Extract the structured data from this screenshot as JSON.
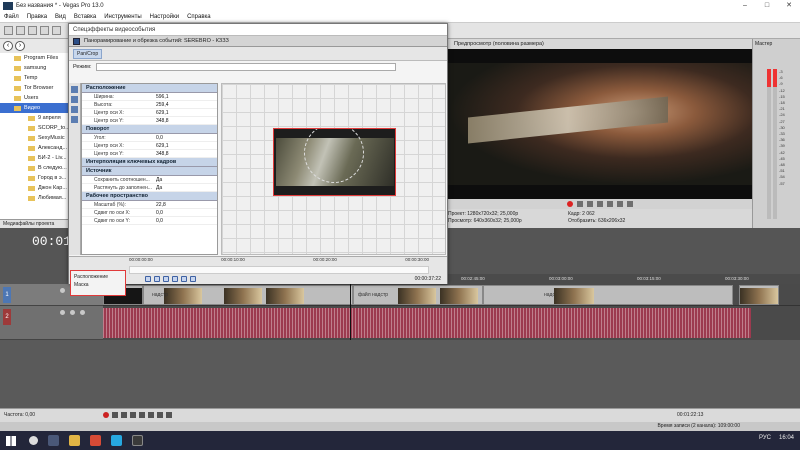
{
  "window": {
    "title": "Без названия * - Vegas Pro 13.0",
    "controls": [
      "–",
      "□",
      "✕"
    ]
  },
  "menu": [
    "Файл",
    "Правка",
    "Вид",
    "Вставка",
    "Инструменты",
    "Настройки",
    "Справка"
  ],
  "explorer": {
    "items": [
      {
        "label": "Program Files",
        "sel": false,
        "sub": false
      },
      {
        "label": "samsung",
        "sel": false,
        "sub": false
      },
      {
        "label": "Temp",
        "sel": false,
        "sub": false
      },
      {
        "label": "Tor Browser",
        "sel": false,
        "sub": false
      },
      {
        "label": "Users",
        "sel": false,
        "sub": false
      },
      {
        "label": "Видео",
        "sel": true,
        "sub": false
      },
      {
        "label": "9 апреля",
        "sel": false,
        "sub": true
      },
      {
        "label": "SCORP_to...",
        "sel": false,
        "sub": true
      },
      {
        "label": "SexyMusic",
        "sel": false,
        "sub": true
      },
      {
        "label": "Александ...",
        "sel": false,
        "sub": true
      },
      {
        "label": "БИ-2 - Liv...",
        "sel": false,
        "sub": true
      },
      {
        "label": "В следую...",
        "sel": false,
        "sub": true
      },
      {
        "label": "Город в э...",
        "sel": false,
        "sub": true
      },
      {
        "label": "Джон Кар...",
        "sel": false,
        "sub": true
      },
      {
        "label": "Любимая...",
        "sel": false,
        "sub": true
      }
    ],
    "footer": "Медиафайлы проекта"
  },
  "dialog": {
    "title": "Спецэффекты видеособытия",
    "event": "Панорамирование и обрезка событий:  SERЕBRO - КЗЗЗ",
    "plugin": "Pan/Crop",
    "preset_label": "Режим:",
    "sections": [
      {
        "head": "Расположение",
        "rows": [
          [
            "Ширина:",
            "596,1"
          ],
          [
            "Высота:",
            "259,4"
          ],
          [
            "Центр оси X:",
            "629,1"
          ],
          [
            "Центр оси Y:",
            "348,8"
          ]
        ]
      },
      {
        "head": "Поворот",
        "rows": [
          [
            "Угол:",
            "0,0"
          ],
          [
            "Центр оси X:",
            "629,1"
          ],
          [
            "Центр оси Y:",
            "348,8"
          ]
        ]
      },
      {
        "head": "Интерполяция ключевых кадров",
        "rows": []
      },
      {
        "head": "Источник",
        "rows": [
          [
            "Сохранить соотношен...",
            "Да"
          ],
          [
            "Растянуть до заполнен...",
            "Да"
          ]
        ]
      },
      {
        "head": "Рабочее пространство",
        "rows": [
          [
            "Масштаб (%):",
            "22,8"
          ],
          [
            "Сдвиг по оси X:",
            "0,0"
          ],
          [
            "Сдвиг по оси Y:",
            "0,0"
          ]
        ]
      }
    ],
    "ruler": [
      "00:00:00:00",
      "00:00:10:00",
      "00:00:20:00",
      "00:00:30:00"
    ],
    "time": "00:00:37:22",
    "pos_box": {
      "line1": "Расположение",
      "line2": "Маска"
    }
  },
  "preview": {
    "title": "Предпросмотр (половина размера)",
    "info_left": [
      "Проект: 1280x720x32; 25,000p",
      "Просмотр: 640x360x32; 25,000p"
    ],
    "info_right": [
      "Кадр:  2 062",
      "Отобразить:  636x206x32"
    ]
  },
  "master": {
    "label": "Мастер",
    "scale": [
      "3",
      "6",
      "9",
      "12",
      "15",
      "18",
      "21",
      "24",
      "27",
      "30",
      "33",
      "36",
      "39",
      "42",
      "45",
      "48",
      "51",
      "54",
      "57"
    ]
  },
  "timeline": {
    "timecode": "00:01:",
    "ruler": [
      "00:01:49:24",
      "00:02:00:00",
      "00:02:15:00",
      "00:02:30:00",
      "00:02:45:00",
      "00:03:00:00",
      "00:03:15:00",
      "00:03:30:00"
    ],
    "clip_labels": [
      "надстр",
      "файл надстр",
      "надстр"
    ],
    "rate": "Частота: 0,00",
    "cursor_time": "00:01:22:13",
    "status": "Время записи (2 канала): 109:00:00"
  },
  "taskbar": {
    "lang": "РУС",
    "clock": "16:04"
  },
  "colors": {
    "selection": "#3b6fd0",
    "audio": "#9c3a4f",
    "accent_red": "#e03a3a"
  }
}
